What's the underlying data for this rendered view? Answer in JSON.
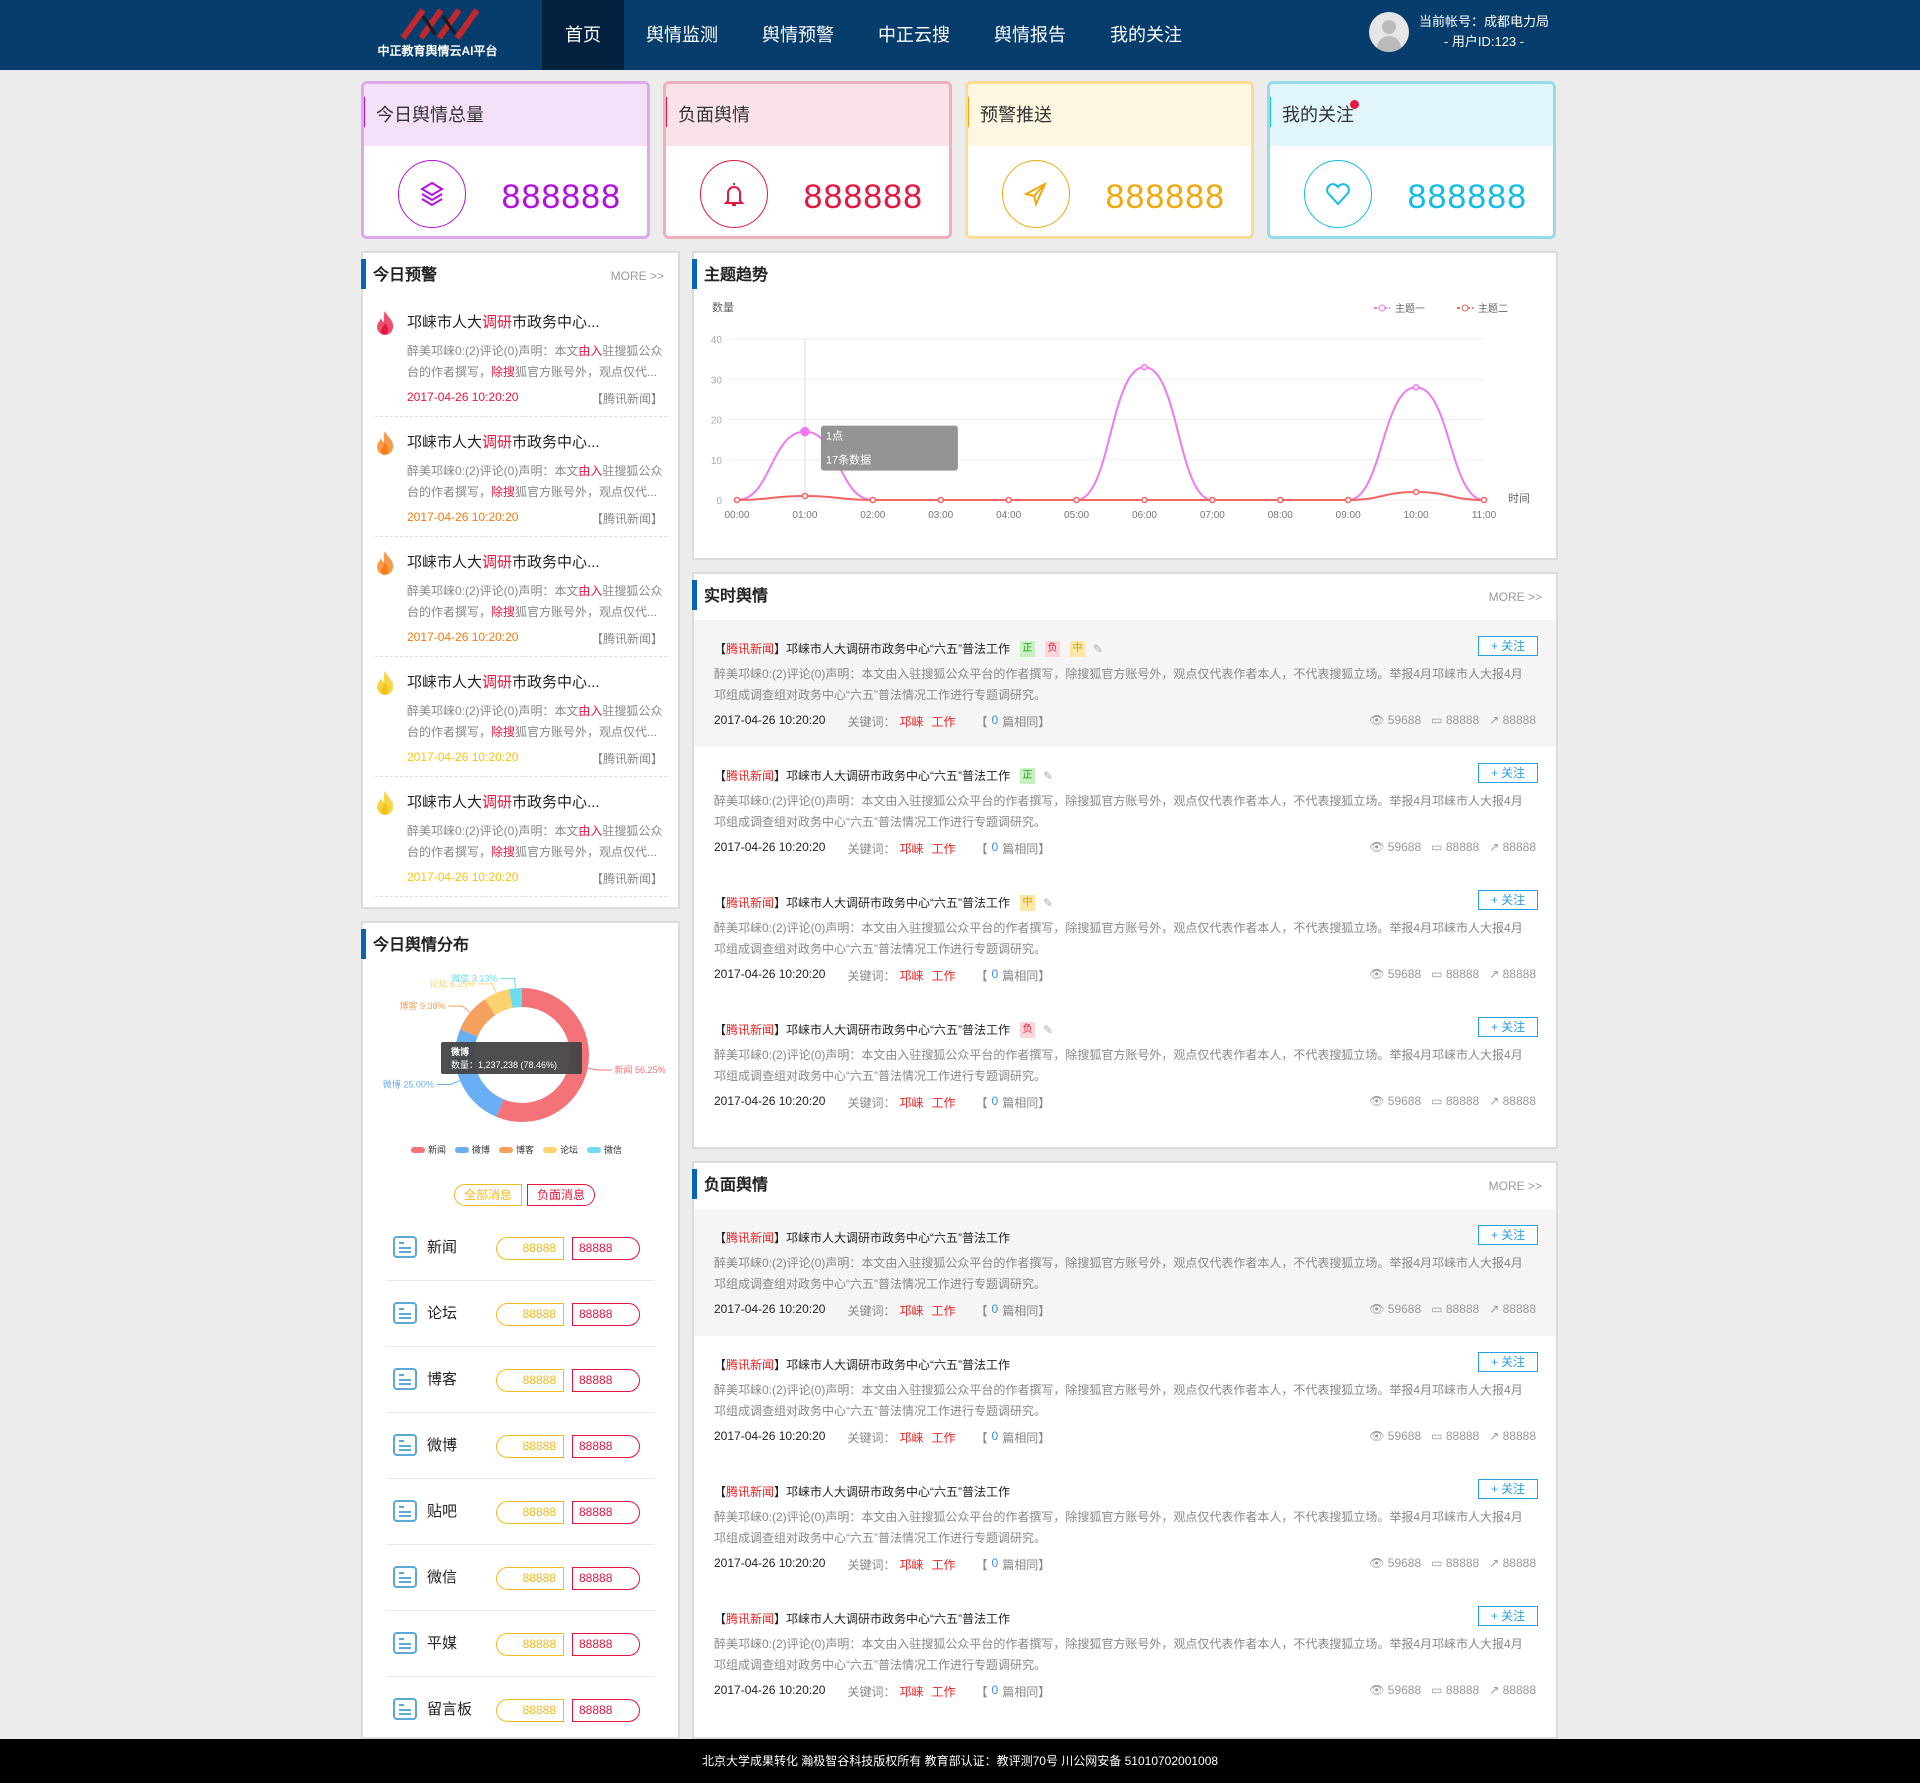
{
  "header": {
    "logo_text": "中正教育舆情云AI平台",
    "nav": [
      "首页",
      "舆情监测",
      "舆情预警",
      "中正云搜",
      "舆情报告",
      "我的关注"
    ],
    "account_label": "当前帐号：成都电力局",
    "user_id": "- 用户ID:123 -"
  },
  "stats": [
    {
      "title": "今日舆情总量",
      "value": "888888",
      "icon": "layers-icon",
      "color": "#b40fdf",
      "bg": "#f4e1f9",
      "border": "#dcaae9"
    },
    {
      "title": "负面舆情",
      "value": "888888",
      "icon": "bell-icon",
      "color": "#e5163f",
      "bg": "#fae3e8",
      "border": "#eeb0bd"
    },
    {
      "title": "预警推送",
      "value": "888888",
      "icon": "send-icon",
      "color": "#f0a80c",
      "bg": "#fdf6e0",
      "border": "#fbdc96"
    },
    {
      "title": "我的关注",
      "value": "888888",
      "icon": "heart-icon",
      "color": "#12bde5",
      "bg": "#e0f6fb",
      "border": "#97dbe9",
      "badge": true
    }
  ],
  "warnings": {
    "title": "今日预警",
    "more": "MORE >>",
    "items": [
      {
        "t1": "邛崃市人大",
        "t2": "调研",
        "t3": "市政务中心...",
        "d1": "醉美邛崃0:(2)评论(0)声明：本文",
        "d2": "由入",
        "d3": "驻搜狐公众台的作者撰写，",
        "d4": "除搜",
        "d5": "狐官方账号外，观点仅代...",
        "date": "2017-04-26 10:20:20",
        "source": "【腾讯新闻】",
        "color": "#e5163f"
      },
      {
        "t1": "邛崃市人大",
        "t2": "调研",
        "t3": "市政务中心...",
        "d1": "醉美邛崃0:(2)评论(0)声明：本文",
        "d2": "由入",
        "d3": "驻搜狐公众台的作者撰写，",
        "d4": "除搜",
        "d5": "狐官方账号外，观点仅代...",
        "date": "2017-04-26 10:20:20",
        "source": "【腾讯新闻】",
        "color": "#f77a14"
      },
      {
        "t1": "邛崃市人大",
        "t2": "调研",
        "t3": "市政务中心...",
        "d1": "醉美邛崃0:(2)评论(0)声明：本文",
        "d2": "由入",
        "d3": "驻搜狐公众台的作者撰写，",
        "d4": "除搜",
        "d5": "狐官方账号外，观点仅代...",
        "date": "2017-04-26 10:20:20",
        "source": "【腾讯新闻】",
        "color": "#f77a14"
      },
      {
        "t1": "邛崃市人大",
        "t2": "调研",
        "t3": "市政务中心...",
        "d1": "醉美邛崃0:(2)评论(0)声明：本文",
        "d2": "由入",
        "d3": "驻搜狐公众台的作者撰写，",
        "d4": "除搜",
        "d5": "狐官方账号外，观点仅代...",
        "date": "2017-04-26 10:20:20",
        "source": "【腾讯新闻】",
        "color": "#f6c40f"
      },
      {
        "t1": "邛崃市人大",
        "t2": "调研",
        "t3": "市政务中心...",
        "d1": "醉美邛崃0:(2)评论(0)声明：本文",
        "d2": "由入",
        "d3": "驻搜狐公众台的作者撰写，",
        "d4": "除搜",
        "d5": "狐官方账号外，观点仅代...",
        "date": "2017-04-26 10:20:20",
        "source": "【腾讯新闻】",
        "color": "#f6c40f"
      }
    ]
  },
  "chart_data": {
    "type": "line",
    "title": "主题趋势",
    "ylabel": "数量",
    "xlabel": "时间",
    "ylim": [
      0,
      40
    ],
    "yticks": [
      0,
      10,
      20,
      30,
      40
    ],
    "categories": [
      "00:00",
      "01:00",
      "02:00",
      "03:00",
      "04:00",
      "05:00",
      "06:00",
      "07:00",
      "08:00",
      "09:00",
      "10:00",
      "11:00"
    ],
    "series": [
      {
        "name": "主题一",
        "color": "#ef7aef",
        "values": [
          0,
          17,
          0,
          0,
          0,
          0,
          33,
          0,
          0,
          0,
          28,
          0
        ]
      },
      {
        "name": "主题二",
        "color": "#f56565",
        "values": [
          0,
          1,
          0,
          0,
          0,
          0,
          0,
          0,
          0,
          0,
          2,
          0
        ]
      }
    ],
    "legend": "top-right",
    "tooltip": {
      "title": "1点",
      "text": "17条数据"
    }
  },
  "realtime": {
    "title": "实时舆情",
    "more": "MORE >>",
    "items": [
      {
        "source": "腾讯新闻",
        "title": "邛崃市人大调研市政务中心“六五”普法工作",
        "tags": [
          "正",
          "负",
          "中"
        ]
      },
      {
        "source": "腾讯新闻",
        "title": "邛崃市人大调研市政务中心“六五”普法工作",
        "tags": [
          "正"
        ]
      },
      {
        "source": "腾讯新闻",
        "title": "邛崃市人大调研市政务中心“六五”普法工作",
        "tags": [
          "中"
        ]
      },
      {
        "source": "腾讯新闻",
        "title": "邛崃市人大调研市政务中心“六五”普法工作",
        "tags": [
          "负"
        ]
      }
    ]
  },
  "negative": {
    "title": "负面舆情",
    "more": "MORE >>",
    "items": [
      {
        "source": "腾讯新闻",
        "title": "邛崃市人大调研市政务中心“六五”普法工作"
      },
      {
        "source": "腾讯新闻",
        "title": "邛崃市人大调研市政务中心“六五”普法工作"
      },
      {
        "source": "腾讯新闻",
        "title": "邛崃市人大调研市政务中心“六五”普法工作"
      },
      {
        "source": "腾讯新闻",
        "title": "邛崃市人大调研市政务中心“六五”普法工作"
      }
    ]
  },
  "item_common": {
    "summary": "醉美邛崃0:(2)评论(0)声明：本文由入驻搜狐公众平台的作者撰写，除搜狐官方账号外，观点仅代表作者本人，不代表搜狐立场。举报4月邛崃市人大报4月邛组成调查组对政务中心“六五”普法情况工作进行专题调研究。",
    "date": "2017-04-26 10:20:20",
    "keyword_label": "关键词：",
    "keywords": [
      "邛崃",
      "工作"
    ],
    "same_open": "【",
    "same_count": "0",
    "same_suffix": "篇相同】",
    "views": "59688",
    "comments": "88888",
    "shares": "88888",
    "follow": "+ 关注"
  },
  "distribution": {
    "title": "今日舆情分布",
    "slices": [
      {
        "name": "新闻",
        "pct": 56.25,
        "color": "#f47378"
      },
      {
        "name": "微博",
        "pct": 25.0,
        "color": "#6aaef5"
      },
      {
        "name": "博客",
        "pct": 9.38,
        "color": "#f4a05e"
      },
      {
        "name": "论坛",
        "pct": 6.25,
        "color": "#fcd36e"
      },
      {
        "name": "微信",
        "pct": 3.13,
        "color": "#6ddcf0"
      }
    ],
    "tooltip": {
      "title": "微博",
      "text": "数量：1,237,238 (78.46%)"
    },
    "btn_all": "全部消息",
    "btn_neg": "负面消息",
    "sources": [
      {
        "name": "新闻",
        "all": "88888",
        "neg": "88888"
      },
      {
        "name": "论坛",
        "all": "88888",
        "neg": "88888"
      },
      {
        "name": "博客",
        "all": "88888",
        "neg": "88888"
      },
      {
        "name": "微博",
        "all": "88888",
        "neg": "88888"
      },
      {
        "name": "贴吧",
        "all": "88888",
        "neg": "88888"
      },
      {
        "name": "微信",
        "all": "88888",
        "neg": "88888"
      },
      {
        "name": "平媒",
        "all": "88888",
        "neg": "88888"
      },
      {
        "name": "留言板",
        "all": "88888",
        "neg": "88888"
      }
    ]
  },
  "footer": "北京大学成果转化  瀚极智谷科技版权所有   教育部认证：教评测70号      川公网安备 51010702001008"
}
